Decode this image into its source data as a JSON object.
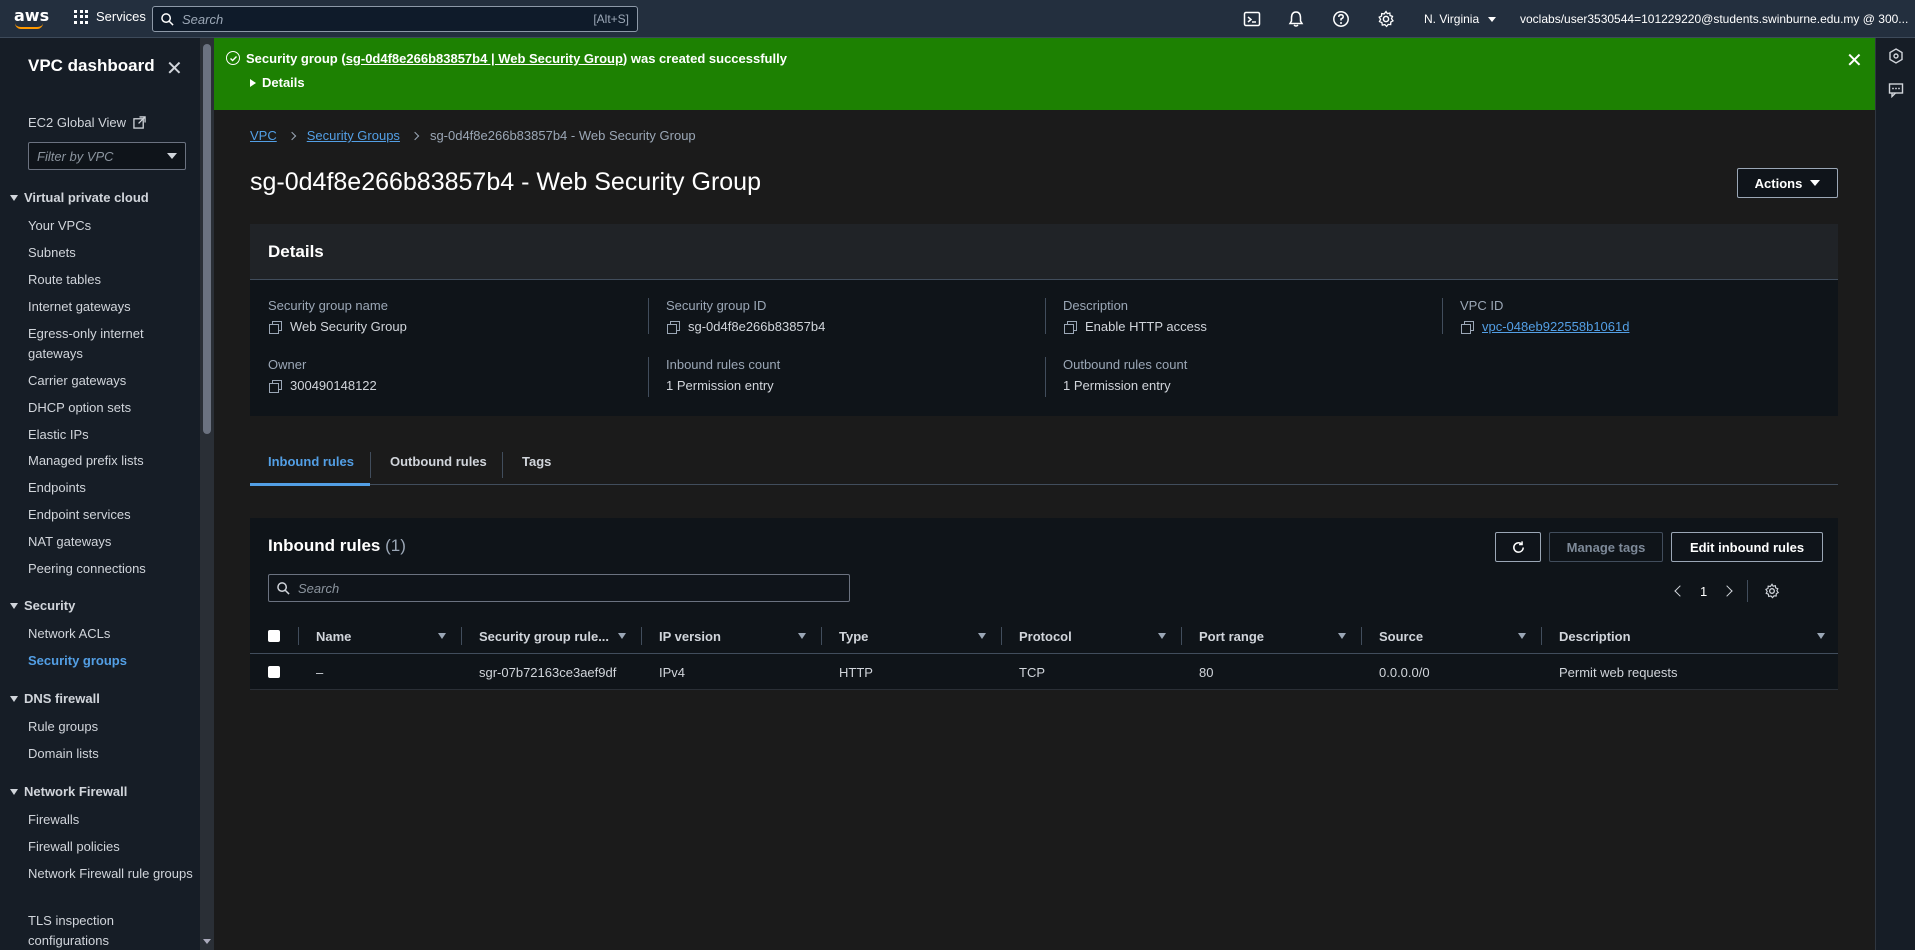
{
  "topbar": {
    "logo": "aws",
    "services_label": "Services",
    "search_placeholder": "Search",
    "search_shortcut": "[Alt+S]",
    "region": "N. Virginia",
    "account": "voclabs/user3530544=101229220@students.swinburne.edu.my @ 300..."
  },
  "sidebar": {
    "title": "VPC dashboard",
    "ec2_global_view": "EC2 Global View",
    "filter_placeholder": "Filter by VPC",
    "sections": [
      {
        "label": "Virtual private cloud",
        "items": [
          "Your VPCs",
          "Subnets",
          "Route tables",
          "Internet gateways",
          "Egress-only internet gateways",
          "Carrier gateways",
          "DHCP option sets",
          "Elastic IPs",
          "Managed prefix lists",
          "Endpoints",
          "Endpoint services",
          "NAT gateways",
          "Peering connections"
        ]
      },
      {
        "label": "Security",
        "items": [
          "Network ACLs",
          "Security groups"
        ]
      },
      {
        "label": "DNS firewall",
        "items": [
          "Rule groups",
          "Domain lists"
        ]
      },
      {
        "label": "Network Firewall",
        "items": [
          "Firewalls",
          "Firewall policies",
          "Network Firewall rule groups",
          "TLS inspection configurations"
        ]
      }
    ],
    "active_item": "Security groups"
  },
  "flash": {
    "prefix": "Security group (",
    "link": "sg-0d4f8e266b83857b4 | Web Security Group",
    "suffix": ") was created successfully",
    "details_label": "Details"
  },
  "breadcrumb": [
    "VPC",
    "Security Groups",
    "sg-0d4f8e266b83857b4 - Web Security Group"
  ],
  "page_title": "sg-0d4f8e266b83857b4 - Web Security Group",
  "actions_label": "Actions",
  "details": {
    "title": "Details",
    "fields": {
      "sg_name": {
        "label": "Security group name",
        "value": "Web Security Group"
      },
      "sg_id": {
        "label": "Security group ID",
        "value": "sg-0d4f8e266b83857b4"
      },
      "description": {
        "label": "Description",
        "value": "Enable HTTP access"
      },
      "vpc_id": {
        "label": "VPC ID",
        "value": "vpc-048eb922558b1061d"
      },
      "owner": {
        "label": "Owner",
        "value": "300490148122"
      },
      "inbound_count": {
        "label": "Inbound rules count",
        "value": "1 Permission entry"
      },
      "outbound_count": {
        "label": "Outbound rules count",
        "value": "1 Permission entry"
      }
    }
  },
  "tabs": [
    "Inbound rules",
    "Outbound rules",
    "Tags"
  ],
  "inbound": {
    "title": "Inbound rules",
    "count": "(1)",
    "manage_tags": "Manage tags",
    "edit_rules": "Edit inbound rules",
    "search_placeholder": "Search",
    "page": "1",
    "columns": [
      "Name",
      "Security group rule...",
      "IP version",
      "Type",
      "Protocol",
      "Port range",
      "Source",
      "Description"
    ],
    "rows": [
      {
        "name": "–",
        "rule_id": "sgr-07b72163ce3aef9df",
        "ip_version": "IPv4",
        "type": "HTTP",
        "protocol": "TCP",
        "port_range": "80",
        "source": "0.0.0.0/0",
        "description": "Permit web requests"
      }
    ]
  }
}
